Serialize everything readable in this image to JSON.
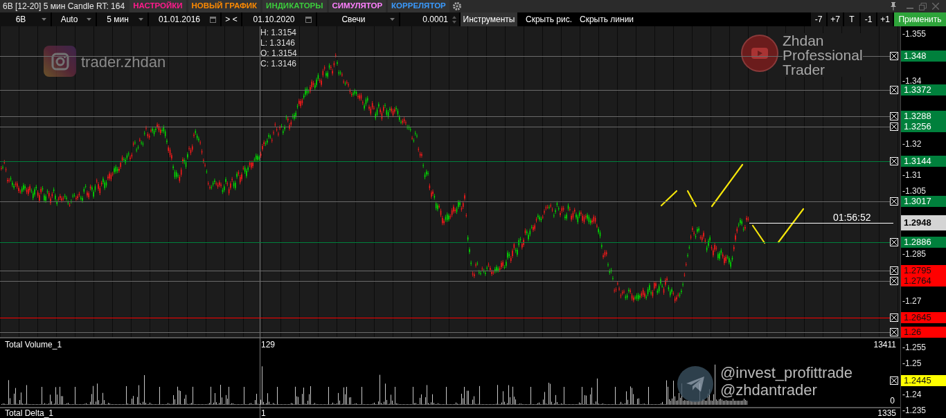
{
  "title_bar": {
    "title": "6B [12-20] 5 мин Candle RT: 164",
    "menu": [
      {
        "label": "НАСТРОЙКИ",
        "color": "#ff1a8c"
      },
      {
        "label": "НОВЫЙ ГРАФИК",
        "color": "#ff8a00"
      },
      {
        "label": "ИНДИКАТОРЫ",
        "color": "#3ccc3c"
      },
      {
        "label": "СИМУЛЯТОР",
        "color": "#ff80ff"
      },
      {
        "label": "КОРРЕЛЯТОР",
        "color": "#3a9bff"
      }
    ]
  },
  "toolbar": {
    "symbol": "6B",
    "mode": "Auto",
    "timeframe": "5 мин",
    "date_from": "01.01.2016",
    "range_separator": "> <",
    "date_to": "01.10.2020",
    "chart_type": "Свечи",
    "tick_size": "0.0001",
    "tools_button": "Инструменты",
    "links": [
      "Скрыть рис.",
      "Скрыть линии"
    ],
    "step_buttons": [
      "-7",
      "+7",
      "T",
      "-1",
      "+1"
    ],
    "apply_button": "Применить"
  },
  "chart": {
    "ohlc": [
      "H: 1.3154",
      "L: 1.3146",
      "O: 1.3154",
      "C: 1.3146"
    ],
    "watermarks": {
      "instagram": "trader.zhdan",
      "youtube": [
        "Zhdan",
        "Professional",
        "Trader"
      ],
      "telegram": [
        "@invest_profittrade",
        "@zhdantrader"
      ]
    },
    "countdown": "01:56:52",
    "current_price": "1.2948",
    "price_ticks": [
      "-1.355",
      "-1.34",
      "-1.32",
      "-1.31",
      "-1.305",
      "-1.285",
      "-1.27",
      "-1.255",
      "-1.25",
      "-1.24",
      "-1.235"
    ],
    "levels": [
      {
        "price": "1.348",
        "color": "#00803c",
        "kind": "minor"
      },
      {
        "price": "1.3372",
        "color": "#00803c",
        "kind": "minor"
      },
      {
        "price": "1.3288",
        "color": "#00803c",
        "kind": "minor"
      },
      {
        "price": "1.3256",
        "color": "#00803c",
        "kind": "minor"
      },
      {
        "price": "1.3144",
        "color": "#00803c",
        "kind": "major"
      },
      {
        "price": "1.3017",
        "color": "#00803c",
        "kind": "minor"
      },
      {
        "price": "1.2886",
        "color": "#00803c",
        "kind": "major"
      },
      {
        "price": "1.2795",
        "color": "#ff0000",
        "kind": "minor"
      },
      {
        "price": "1.2764",
        "color": "#ff0000",
        "kind": "minor"
      },
      {
        "price": "1.2645",
        "color": "#ff0000",
        "kind": "major"
      },
      {
        "price": "1.26",
        "color": "#ff0000",
        "kind": "minor"
      },
      {
        "price": "1.2445",
        "color": "#ffff00",
        "kind": "marker"
      }
    ]
  },
  "volume_panel": {
    "title": "Total Volume_1",
    "cursor_value": "129",
    "max_value": "13411",
    "min_value": "0"
  },
  "delta_panel": {
    "title": "Total Delta_1",
    "cursor_value": "1",
    "max_value": "1335"
  }
}
